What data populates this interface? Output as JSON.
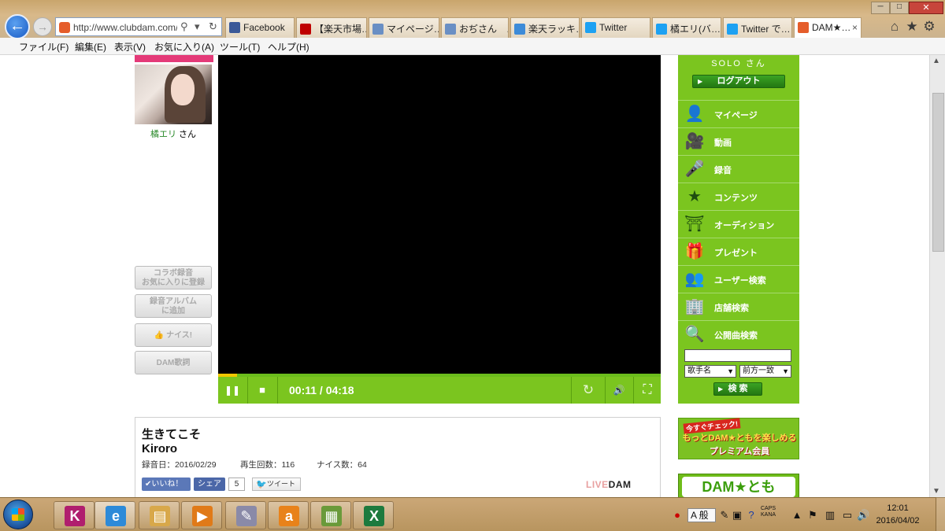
{
  "browser": {
    "address": "http://www.clubdam.com/a",
    "tabs": [
      {
        "label": "Facebook",
        "icon": "facebook-icon",
        "color": "#3b5998"
      },
      {
        "label": "【楽天市場…",
        "icon": "rakuten-icon",
        "color": "#bf0000"
      },
      {
        "label": "マイページ…",
        "icon": "page-icon",
        "color": "#6a8fc4"
      },
      {
        "label": "おぢさん　…",
        "icon": "page-icon",
        "color": "#6a8fc4"
      },
      {
        "label": "楽天ラッキ…",
        "icon": "ie-icon",
        "color": "#3d8bd8"
      },
      {
        "label": "Twitter",
        "icon": "twitter-icon",
        "color": "#1da1f2"
      },
      {
        "label": "橘エリ(バ…",
        "icon": "twitter-icon",
        "color": "#1da1f2"
      },
      {
        "label": "Twitter で…",
        "icon": "twitter-icon",
        "color": "#1da1f2"
      },
      {
        "label": "DAM★…",
        "icon": "dam-icon",
        "color": "#e55d2b"
      }
    ],
    "menu": [
      "ファイル(F)",
      "編集(E)",
      "表示(V)",
      "お気に入り(A)",
      "ツール(T)",
      "ヘルプ(H)"
    ],
    "tab_close": "×"
  },
  "profile": {
    "name": "橘エリ",
    "suffix": " さん"
  },
  "side_buttons": [
    {
      "line1": "コラボ録音",
      "line2": "お気に入りに登録"
    },
    {
      "line1": "録音アルバム",
      "line2": "に追加"
    },
    {
      "line1": "👍 ナイス!",
      "line2": ""
    },
    {
      "line1": "DAM歌詞",
      "line2": ""
    }
  ],
  "player": {
    "time": "00:11 / 04:18",
    "progress": 0.043,
    "pause_icon": "❚❚",
    "stop_icon": "■",
    "repeat_icon": "↻",
    "volume_icon": "🔊",
    "fullscreen_icon": "⛶"
  },
  "song": {
    "title": "生きてこそ",
    "artist": "Kiroro",
    "recorded": "録音日：2016/02/29",
    "plays": "再生回数：116",
    "nice": "ナイス数：64",
    "like": "いいね！",
    "share": "シェア",
    "share_count": "5",
    "tweet": "ツイート",
    "logo_live": "LIVE",
    "logo_dam": "DAM"
  },
  "nav": {
    "user": "SOLO さん",
    "logout": "ログアウト",
    "items": [
      {
        "label": "マイページ",
        "icon": "person-icon",
        "glyph": "👤"
      },
      {
        "label": "動画",
        "icon": "video-camera-icon",
        "glyph": "🎥"
      },
      {
        "label": "録音",
        "icon": "microphone-icon",
        "glyph": "🎤"
      },
      {
        "label": "コンテンツ",
        "icon": "star-icon",
        "glyph": "★"
      },
      {
        "label": "オーディション",
        "icon": "gate-icon",
        "glyph": "⛩"
      },
      {
        "label": "プレゼント",
        "icon": "gift-icon",
        "glyph": "🎁"
      },
      {
        "label": "ユーザー検索",
        "icon": "users-icon",
        "glyph": "👥"
      },
      {
        "label": "店舗検索",
        "icon": "building-icon",
        "glyph": "🏢"
      },
      {
        "label": "公開曲検索",
        "icon": "music-search-icon",
        "glyph": "🔍"
      }
    ],
    "search_field": "歌手名",
    "search_match": "前方一致",
    "search_button": "検 索"
  },
  "banners": {
    "promo_line1": "今すぐチェック!",
    "promo_line2": "もっとDAM★ともを楽しめる",
    "promo_line3": "プレミアム会員",
    "damtomo": "DAM★とも"
  },
  "taskbar": {
    "ime": "A 般",
    "caps": "CAPS",
    "kana": "KANA",
    "time": "12:01",
    "date": "2016/04/02",
    "apps": [
      {
        "name": "taskbar-kindle",
        "glyph": "K",
        "color": "#b01e6e"
      },
      {
        "name": "taskbar-ie",
        "glyph": "e",
        "color": "#2d8ad8"
      },
      {
        "name": "taskbar-explorer",
        "glyph": "▤",
        "color": "#d8a84a"
      },
      {
        "name": "taskbar-media-player",
        "glyph": "▶",
        "color": "#e07a18"
      },
      {
        "name": "taskbar-paint",
        "glyph": "✎",
        "color": "#8a8aa8"
      },
      {
        "name": "taskbar-amazon",
        "glyph": "a",
        "color": "#e8821a"
      },
      {
        "name": "taskbar-folder",
        "glyph": "▦",
        "color": "#6a9a3a"
      },
      {
        "name": "taskbar-excel",
        "glyph": "X",
        "color": "#1d7a3e"
      }
    ]
  }
}
